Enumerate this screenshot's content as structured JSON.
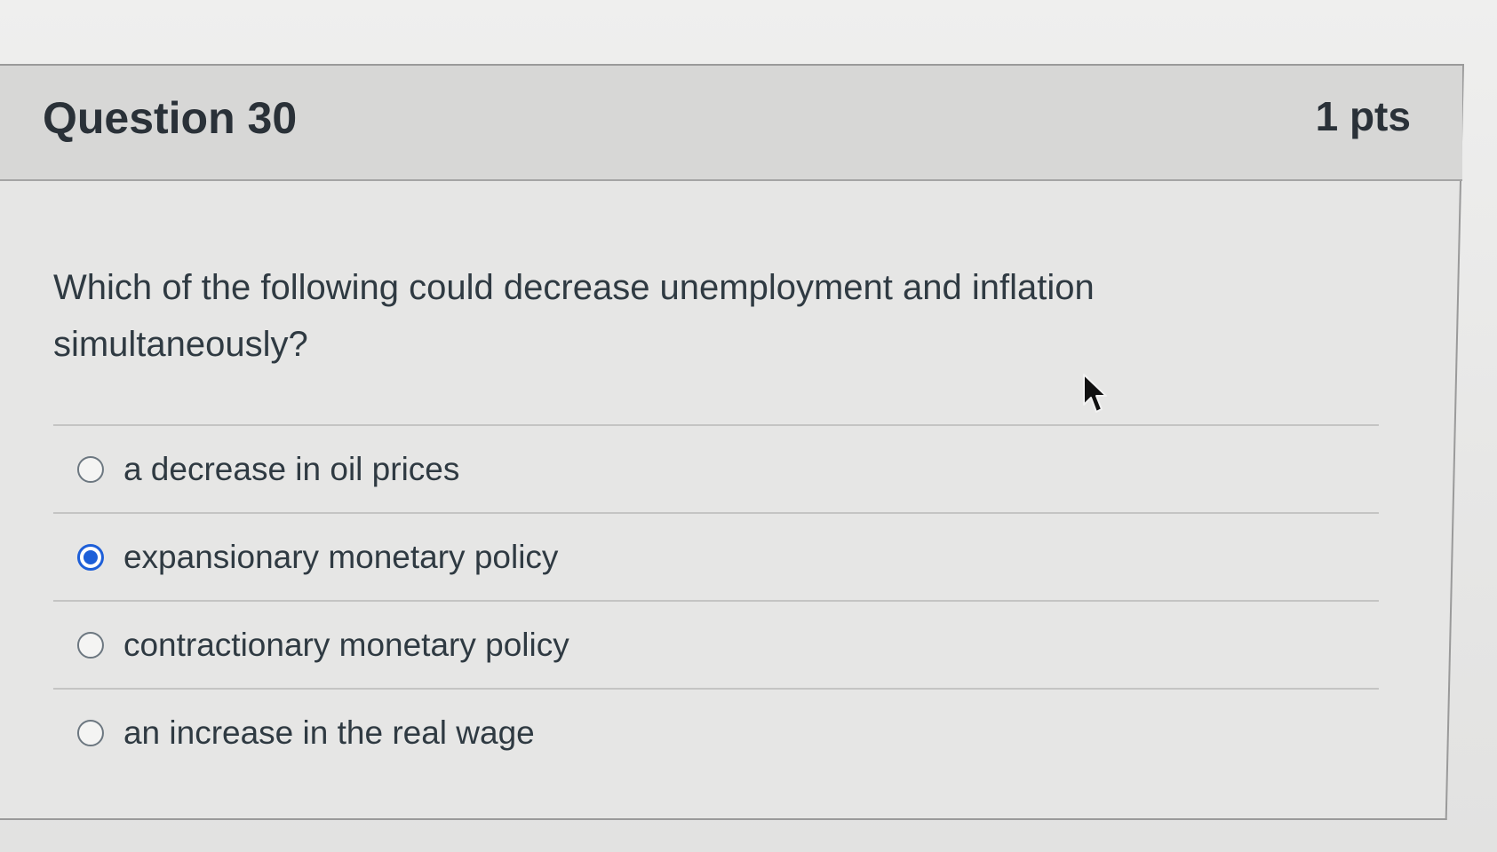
{
  "question": {
    "title": "Question 30",
    "points": "1 pts",
    "text": "Which of the following could decrease unemployment and inflation simultaneously?"
  },
  "answers": [
    {
      "label": "a decrease in oil prices",
      "selected": false
    },
    {
      "label": "expansionary monetary policy",
      "selected": true
    },
    {
      "label": "contractionary monetary policy",
      "selected": false
    },
    {
      "label": "an increase in the real wage",
      "selected": false
    }
  ],
  "colors": {
    "accent": "#1e5fd8",
    "header_bg": "#d7d7d6",
    "text": "#2f3a42"
  },
  "icons": {
    "pointer": "mouse-pointer-icon"
  }
}
